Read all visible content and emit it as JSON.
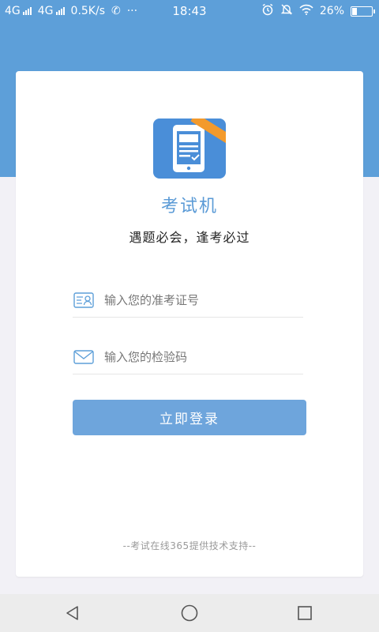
{
  "status_bar": {
    "network_1": "4G",
    "network_2": "4G",
    "speed": "0.5K/s",
    "more": "···",
    "time": "18:43",
    "battery_text": "26%",
    "battery_level": 0.26
  },
  "colors": {
    "header": "#5d9fd9",
    "accent_text": "#5a9ad6",
    "button": "#6ea5dc",
    "ribbon": "#f39a2c"
  },
  "app": {
    "name": "考试机",
    "slogan": "遇题必会，逢考必过",
    "icon": "tablet-exam-icon"
  },
  "form": {
    "id_field": {
      "icon": "id-card-icon",
      "placeholder": "输入您的准考证号",
      "value": ""
    },
    "code_field": {
      "icon": "envelope-icon",
      "placeholder": "输入您的检验码",
      "value": ""
    },
    "login_label": "立即登录"
  },
  "footer": "--考试在线365提供技术支持--",
  "nav": {
    "back": "back-triangle-icon",
    "home": "home-circle-icon",
    "recent": "recent-square-icon"
  }
}
